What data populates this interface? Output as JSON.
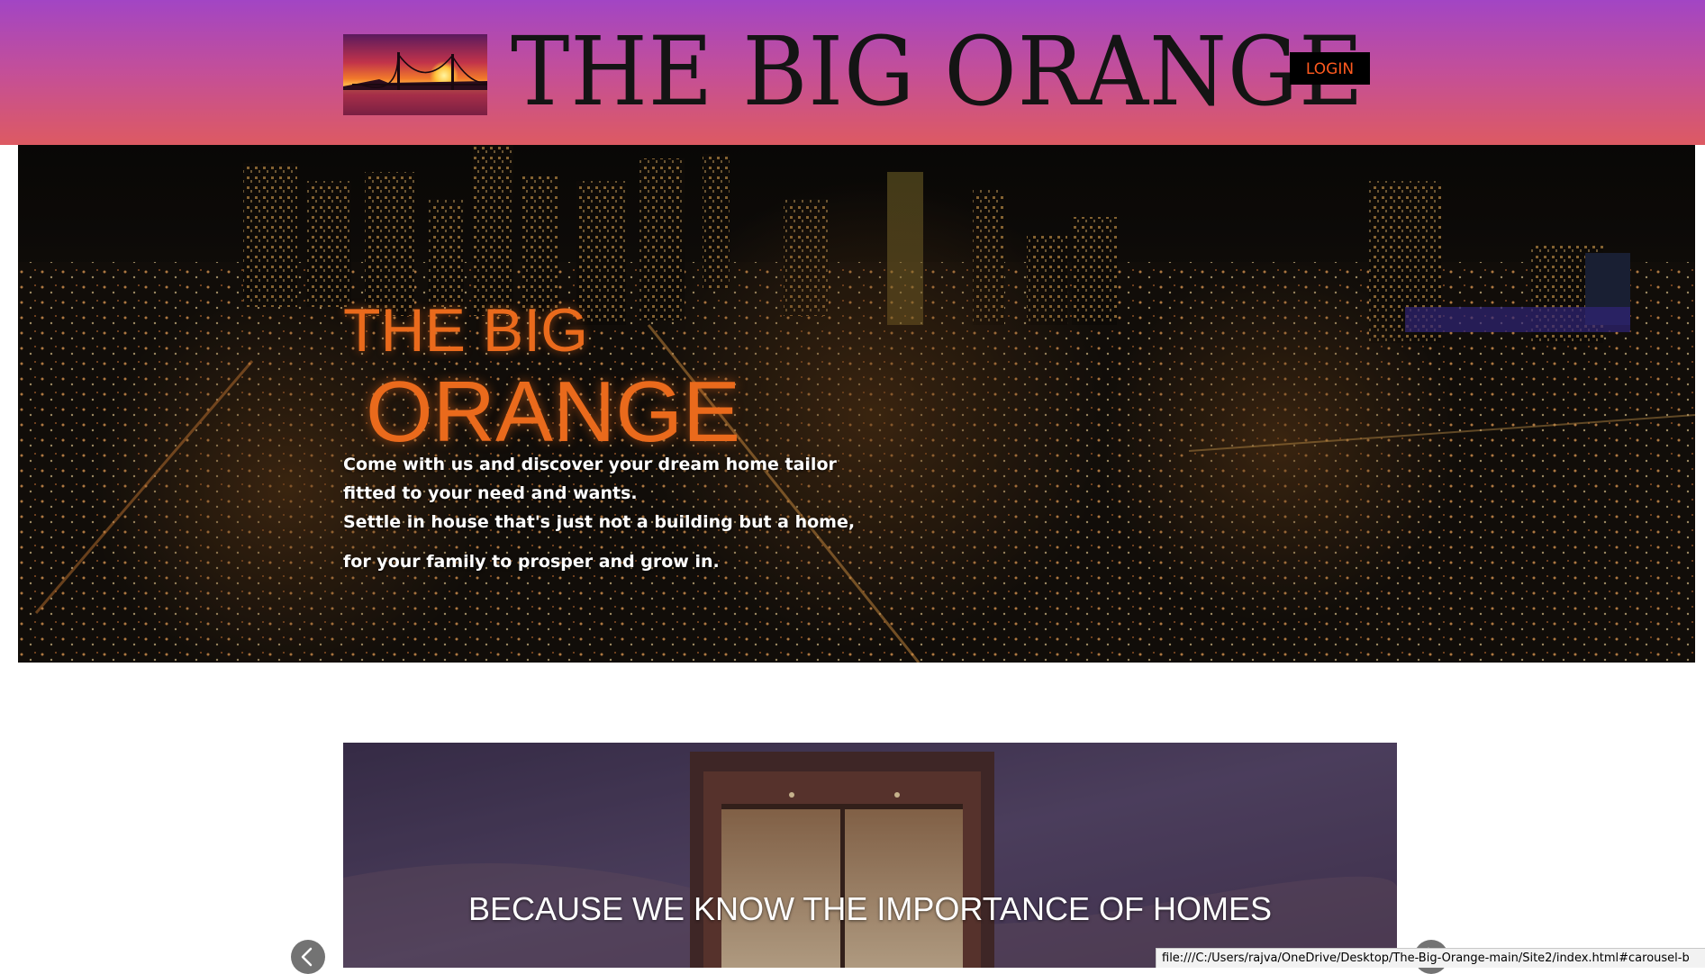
{
  "header": {
    "logo_alt": "sunset bridge logo",
    "title": "THE BIG ORANGE",
    "login_label": "LOGIN"
  },
  "hero": {
    "title_line1": "THE BIG",
    "title_line2": "ORANGE",
    "lines": [
      "Come with us and discover your dream home tailor",
      "fitted to your need and wants.",
      "Settle in house that's just not a building but a home,",
      "for your family to prosper and grow in."
    ]
  },
  "carousel": {
    "caption": "BECAUSE WE KNOW THE IMPORTANCE OF HOMES",
    "prev_icon": "chevron-left-icon",
    "next_icon": "chevron-right-icon"
  },
  "status_bar": {
    "url": "file:///C:/Users/rajva/OneDrive/Desktop/The-Big-Orange-main/Site2/index.html#carousel-b"
  },
  "colors": {
    "accent_orange": "#ea6a1c",
    "login_text": "#ff5a1f",
    "header_top": "#a245c4",
    "header_bottom": "#dd5a62"
  }
}
